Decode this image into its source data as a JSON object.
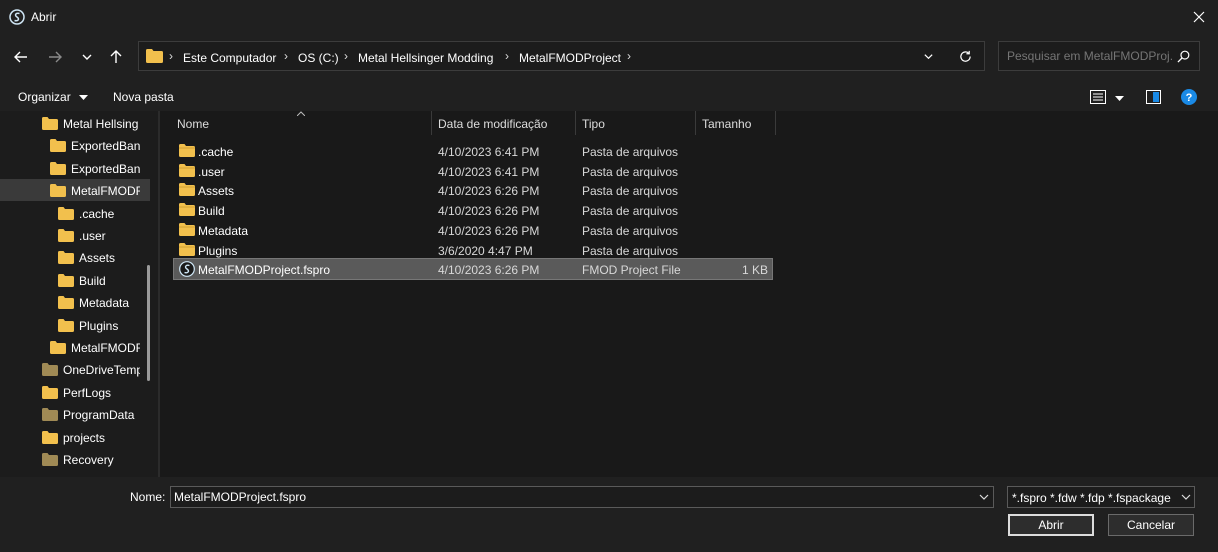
{
  "window": {
    "title": "Abrir"
  },
  "address": {
    "crumbs": [
      "Este Computador",
      "OS (C:)",
      "Metal Hellsinger Modding",
      "MetalFMODProject"
    ]
  },
  "search": {
    "placeholder": "Pesquisar em MetalFMODProj..."
  },
  "commandbar": {
    "organize": "Organizar",
    "new_folder": "Nova pasta"
  },
  "navtree": {
    "items": [
      {
        "label": "Metal Hellsing",
        "indent": 1
      },
      {
        "label": "ExportedBan",
        "indent": 2
      },
      {
        "label": "ExportedBan",
        "indent": 2
      },
      {
        "label": "MetalFMODF",
        "indent": 2,
        "selected": true
      },
      {
        "label": ".cache",
        "indent": 3
      },
      {
        "label": ".user",
        "indent": 3
      },
      {
        "label": "Assets",
        "indent": 3
      },
      {
        "label": "Build",
        "indent": 3
      },
      {
        "label": "Metadata",
        "indent": 3
      },
      {
        "label": "Plugins",
        "indent": 3
      },
      {
        "label": "MetalFMODF",
        "indent": 2
      },
      {
        "label": "OneDriveTemp",
        "indent": 1
      },
      {
        "label": "PerfLogs",
        "indent": 1
      },
      {
        "label": "ProgramData",
        "indent": 1
      },
      {
        "label": "projects",
        "indent": 1
      },
      {
        "label": "Recovery",
        "indent": 1
      }
    ]
  },
  "columns": {
    "name": "Nome",
    "date": "Data de modificação",
    "type": "Tipo",
    "size": "Tamanho"
  },
  "files": [
    {
      "name": ".cache",
      "date": "4/10/2023 6:41 PM",
      "type": "Pasta de arquivos",
      "size": "",
      "kind": "folder"
    },
    {
      "name": ".user",
      "date": "4/10/2023 6:41 PM",
      "type": "Pasta de arquivos",
      "size": "",
      "kind": "folder"
    },
    {
      "name": "Assets",
      "date": "4/10/2023 6:26 PM",
      "type": "Pasta de arquivos",
      "size": "",
      "kind": "folder"
    },
    {
      "name": "Build",
      "date": "4/10/2023 6:26 PM",
      "type": "Pasta de arquivos",
      "size": "",
      "kind": "folder"
    },
    {
      "name": "Metadata",
      "date": "4/10/2023 6:26 PM",
      "type": "Pasta de arquivos",
      "size": "",
      "kind": "folder"
    },
    {
      "name": "Plugins",
      "date": "3/6/2020 4:47 PM",
      "type": "Pasta de arquivos",
      "size": "",
      "kind": "folder"
    },
    {
      "name": "MetalFMODProject.fspro",
      "date": "4/10/2023 6:26 PM",
      "type": "FMOD Project File",
      "size": "1 KB",
      "kind": "fmod",
      "selected": true
    }
  ],
  "bottom": {
    "name_label": "Nome:",
    "name_value": "MetalFMODProject.fspro",
    "filter": "*.fspro *.fdw *.fdp *.fspackage",
    "open": "Abrir",
    "cancel": "Cancelar"
  },
  "colors": {
    "folder": "#f2c04d",
    "folder_dark": "#c99a2e",
    "accent": "#1a8ae6"
  }
}
